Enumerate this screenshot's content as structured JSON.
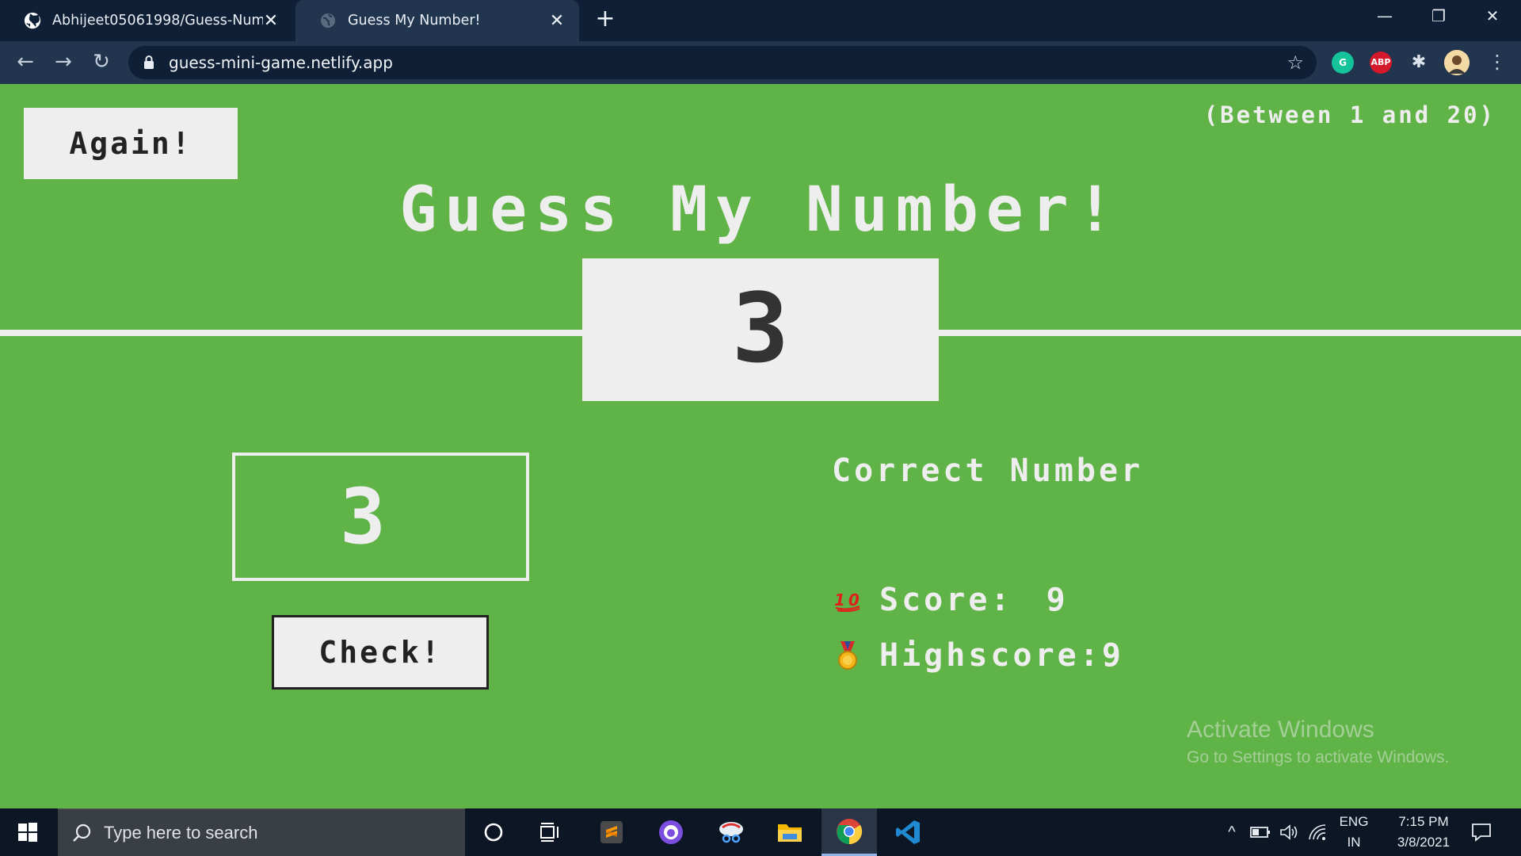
{
  "browser": {
    "tabs": [
      {
        "title": "Abhijeet05061998/Guess-Number-Game",
        "favicon": "github-icon"
      },
      {
        "title": "Guess My Number!",
        "favicon": "globe-icon"
      }
    ],
    "url": "guess-mini-game.netlify.app",
    "extensions": [
      "grammarly-icon",
      "adblock-icon",
      "puzzle-icon",
      "avatar"
    ],
    "adblock_label": "ABP"
  },
  "game": {
    "again_label": "Again!",
    "range_text": "(Between 1 and 20)",
    "title": "Guess My Number!",
    "secret_number": "3",
    "guess_value": "3",
    "check_label": "Check!",
    "message": "Correct Number",
    "score_label": "Score: ",
    "score_value": "9",
    "highscore_label": "Highscore:",
    "highscore_value": "9",
    "score_emoji": "💯",
    "highscore_emoji": "🥇"
  },
  "watermark": {
    "line1": "Activate Windows",
    "line2": "Go to Settings to activate Windows."
  },
  "taskbar": {
    "search_placeholder": "Type here to search",
    "apps": [
      "cortana-icon",
      "task-view-icon",
      "sublime-text-icon",
      "github-desktop-icon",
      "snipping-tool-icon",
      "file-explorer-icon",
      "chrome-icon",
      "vscode-icon"
    ],
    "language_top": "ENG",
    "language_bottom": "IN",
    "time": "7:15 PM",
    "date": "3/8/2021"
  },
  "colors": {
    "page_bg": "#60b347",
    "text_light": "#eeeeee",
    "text_dark": "#333333",
    "chrome_dark": "#0f1f35",
    "chrome_mid": "#22354f"
  }
}
